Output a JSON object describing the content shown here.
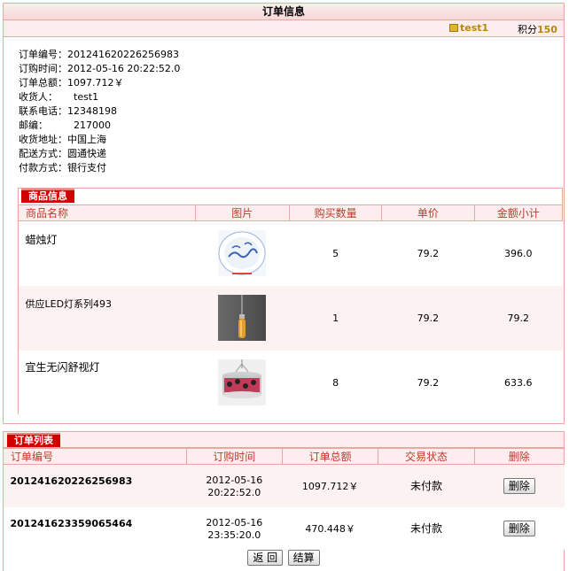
{
  "header": {
    "title": "订单信息"
  },
  "user": {
    "name": "test1",
    "points_label": "积分",
    "points": "150"
  },
  "order_info": {
    "rows": [
      {
        "label": "订单编号：",
        "value": "201241620226256983"
      },
      {
        "label": "订购时间：",
        "value": "2012-05-16 20:22:52.0"
      },
      {
        "label": "订单总额：",
        "value": "1097.712￥"
      },
      {
        "label": "收货人：",
        "value": "test1"
      },
      {
        "label": "联系电话：",
        "value": "12348198"
      },
      {
        "label": "邮编：",
        "value": "217000"
      },
      {
        "label": "收货地址：",
        "value": "中国上海"
      },
      {
        "label": "配送方式：",
        "value": "圆通快递"
      },
      {
        "label": "付款方式：",
        "value": "银行支付"
      }
    ]
  },
  "goods": {
    "tag": "商品信息",
    "columns": [
      "商品名称",
      "图片",
      "购买数量",
      "单价",
      "金额小计"
    ],
    "rows": [
      {
        "name": "蜡烛灯",
        "image": "ceiling-lamp-image",
        "qty": "5",
        "price": "79.2",
        "subtotal": "396.0"
      },
      {
        "name": "供应LED灯系列493",
        "image": "pendant-lamp-image",
        "qty": "1",
        "price": "79.2",
        "subtotal": "79.2"
      },
      {
        "name": "宜生无闪舒视灯",
        "image": "chandelier-image",
        "qty": "8",
        "price": "79.2",
        "subtotal": "633.6"
      }
    ]
  },
  "orders": {
    "tag": "订单列表",
    "columns": [
      "订单编号",
      "订购时间",
      "订单总额",
      "交易状态",
      "删除"
    ],
    "rows": [
      {
        "id": "201241620226256983",
        "date": "2012-05-16",
        "time": "20:22:52.0",
        "total": "1097.712￥",
        "status": "未付款",
        "delete": "删除"
      },
      {
        "id": "201241623359065464",
        "date": "2012-05-16",
        "time": "23:35:20.0",
        "total": "470.448￥",
        "status": "未付款",
        "delete": "删除"
      }
    ]
  },
  "actions": {
    "back": "返 回",
    "checkout": "结算"
  },
  "colors": {
    "accent": "#d30000",
    "border": "#e8a8a0",
    "header_text": "#c0392b",
    "gold": "#b8860b"
  }
}
